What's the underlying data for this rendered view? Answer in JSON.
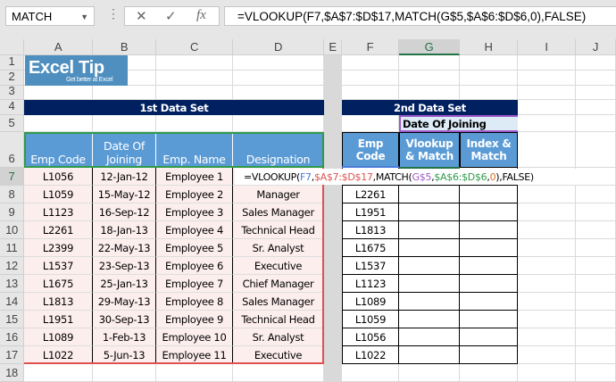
{
  "name_box": "MATCH",
  "formula_bar": "=VLOOKUP(F7,$A$7:$D$17,MATCH(G$5,$A$6:$D$6,0),FALSE)",
  "icons": {
    "cancel": "✕",
    "enter": "✓",
    "fx": "fx"
  },
  "columns": [
    "A",
    "B",
    "C",
    "D",
    "E",
    "F",
    "G",
    "H",
    "I",
    "J"
  ],
  "rows": [
    "1",
    "2",
    "3",
    "4",
    "5",
    "6",
    "7",
    "8",
    "9",
    "10",
    "11",
    "12",
    "13",
    "14",
    "15",
    "16",
    "17",
    "18"
  ],
  "logo": {
    "title1": "Excel",
    "title2": "Tip",
    "tagline": "Get better at Excel"
  },
  "set1_title": "1st Data Set",
  "set2_title": "2nd Data Set",
  "g5": "Date Of Joining",
  "headers1": [
    "Emp Code",
    "Date Of\nJoining",
    "Emp. Name",
    "Designation"
  ],
  "headers2": [
    "Emp\nCode",
    "Vlookup\n& Match",
    "Index &\nMatch"
  ],
  "table1": [
    [
      "L1056",
      "12-Jan-12",
      "Employee 1",
      ""
    ],
    [
      "L1059",
      "15-May-12",
      "Employee 2",
      "Manager"
    ],
    [
      "L1123",
      "16-Sep-12",
      "Employee 3",
      "Sales Manager"
    ],
    [
      "L2261",
      "18-Jan-13",
      "Employee 4",
      "Technical Head"
    ],
    [
      "L2399",
      "22-May-13",
      "Employee 5",
      "Sr. Analyst"
    ],
    [
      "L1537",
      "23-Sep-13",
      "Employee 6",
      "Executive"
    ],
    [
      "L1675",
      "25-Jan-13",
      "Employee 7",
      "Chief Manager"
    ],
    [
      "L1813",
      "29-May-13",
      "Employee 8",
      "Sales Manager"
    ],
    [
      "L1951",
      "30-Sep-13",
      "Employee 9",
      "Technical Head"
    ],
    [
      "L1089",
      "1-Feb-13",
      "Employee 10",
      "Sr. Analyst"
    ],
    [
      "L1022",
      "5-Jun-13",
      "Employee 11",
      "Executive"
    ]
  ],
  "table2_codes": [
    "",
    "L2261",
    "L1951",
    "L1813",
    "L1675",
    "L1537",
    "L1123",
    "L1089",
    "L1059",
    "L1056",
    "L1022"
  ],
  "edit_formula": [
    {
      "t": "=VLOOKUP(",
      "c": "#000"
    },
    {
      "t": "F7",
      "c": "#4a7ad8"
    },
    {
      "t": ",",
      "c": "#000"
    },
    {
      "t": "$A$7:$D$17",
      "c": "#e05050"
    },
    {
      "t": ",MATCH(",
      "c": "#000"
    },
    {
      "t": "G$5",
      "c": "#9b59c9"
    },
    {
      "t": ",",
      "c": "#000"
    },
    {
      "t": "$A$6:$D$6",
      "c": "#2e9a4a"
    },
    {
      "t": ",",
      "c": "#000"
    },
    {
      "t": "0",
      "c": "#d07020"
    },
    {
      "t": "),FALSE)",
      "c": "#000"
    }
  ],
  "colors": {
    "navy": "#002060",
    "header_blue": "#5b9bd5",
    "light_blue": "#ddebf7",
    "pink": "#fdeeee"
  }
}
